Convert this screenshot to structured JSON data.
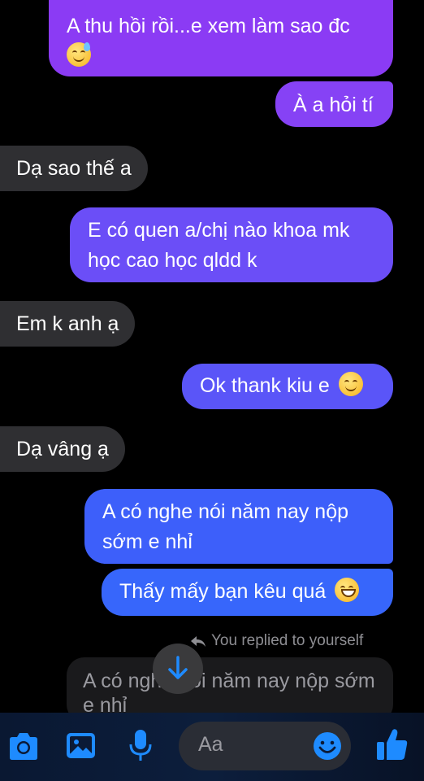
{
  "messages": [
    {
      "text": "A thu hồi rồi...e xem làm sao đc",
      "emoji": "grinning-sweat-emoji",
      "side": "out"
    },
    {
      "text": "À a hỏi tí",
      "side": "out"
    },
    {
      "text": "Dạ sao thế a",
      "side": "in"
    },
    {
      "text": "E có quen a/chị nào khoa mk học cao học qldd k",
      "side": "out"
    },
    {
      "text": "Em k anh ạ",
      "side": "in"
    },
    {
      "text": "Ok thank kiu e",
      "emoji": "smiling-emoji",
      "side": "out"
    },
    {
      "text": "Dạ vâng ạ",
      "side": "in"
    },
    {
      "text": "A có nghe nói năm nay nộp sớm e nhỉ",
      "side": "out"
    },
    {
      "text": "Thấy mấy bạn kêu quá",
      "emoji": "grinning-emoji",
      "side": "out"
    }
  ],
  "reply": {
    "label": "You replied to yourself",
    "quoted_text": "A có nghe nói năm nay nộp sớm e nhỉ"
  },
  "composer": {
    "placeholder": "Aa"
  },
  "icons": [
    "camera-icon",
    "photo-icon",
    "microphone-icon",
    "emoji-icon",
    "thumbs-up-icon",
    "arrow-down-icon",
    "reply-arrow-icon"
  ],
  "colors": {
    "outgoing_top": "#8a3cf5",
    "outgoing_bottom": "#2f6bff",
    "incoming": "#2f2f32",
    "accent": "#1877f2"
  }
}
